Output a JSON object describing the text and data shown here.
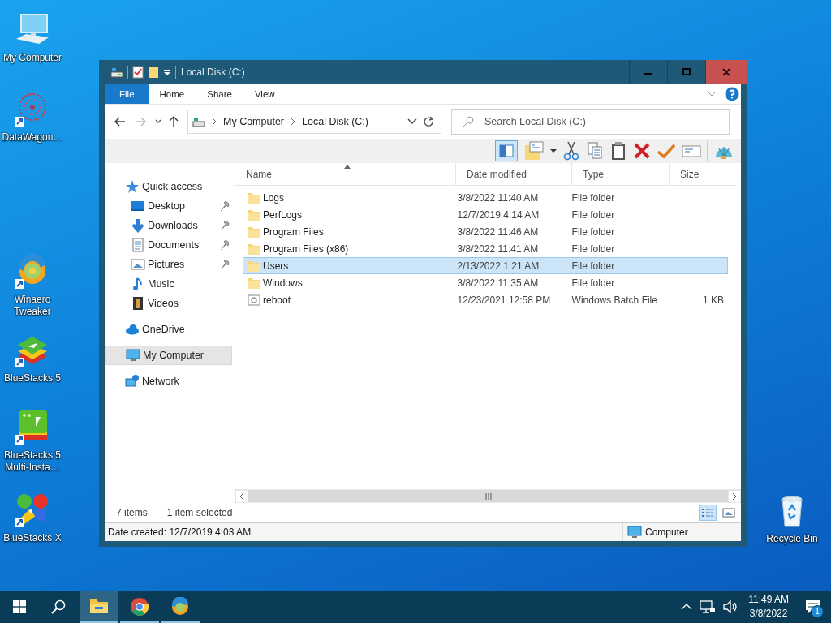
{
  "desktop_icons": [
    {
      "label": "My Computer",
      "kind": "computer",
      "shortcut": false
    },
    {
      "label": "DataWagon…",
      "kind": "datawagon",
      "shortcut": true
    },
    {
      "label": "Winaero Tweaker",
      "kind": "swirl",
      "shortcut": true
    },
    {
      "label": "BlueStacks 5",
      "kind": "stack",
      "shortcut": true
    },
    {
      "label": "BlueStacks 5 Multi-Insta…",
      "kind": "multi",
      "shortcut": true
    },
    {
      "label": "BlueStacks X",
      "kind": "xlogo",
      "shortcut": true
    },
    {
      "label": "Recycle Bin",
      "kind": "recycle",
      "shortcut": false
    }
  ],
  "window": {
    "title": "Local Disk (C:)",
    "ribbon_tabs": [
      {
        "label": "File",
        "kind": "file"
      },
      {
        "label": "Home",
        "kind": "tab"
      },
      {
        "label": "Share",
        "kind": "tab"
      },
      {
        "label": "View",
        "kind": "tab"
      }
    ],
    "breadcrumb": [
      "My Computer",
      "Local Disk (C:)"
    ],
    "search": {
      "placeholder": "Search Local Disk (C:)"
    },
    "nav": [
      {
        "label": "Quick access",
        "kind": "star",
        "selected": false,
        "children": [
          {
            "label": "Desktop",
            "kind": "desktop",
            "pinned": true,
            "selected": false
          },
          {
            "label": "Downloads",
            "kind": "download",
            "pinned": true,
            "selected": false
          },
          {
            "label": "Documents",
            "kind": "document",
            "pinned": true,
            "selected": false
          },
          {
            "label": "Pictures",
            "kind": "pictures",
            "pinned": true,
            "selected": false
          },
          {
            "label": "Music",
            "kind": "music",
            "pinned": false,
            "selected": false
          },
          {
            "label": "Videos",
            "kind": "videos",
            "pinned": false,
            "selected": false
          }
        ]
      },
      {
        "label": "OneDrive",
        "kind": "cloud",
        "selected": false
      },
      {
        "label": "My Computer",
        "kind": "computer",
        "selected": true
      },
      {
        "label": "Network",
        "kind": "network",
        "selected": false
      }
    ],
    "columns": [
      "Name",
      "Date modified",
      "Type",
      "Size"
    ],
    "rows": [
      {
        "name": "Logs",
        "date": "3/8/2022 11:40 AM",
        "type": "File folder",
        "kind": "folder",
        "selected": false
      },
      {
        "name": "PerfLogs",
        "date": "12/7/2019 4:14 AM",
        "type": "File folder",
        "kind": "folder",
        "selected": false
      },
      {
        "name": "Program Files",
        "date": "3/8/2022 11:46 AM",
        "type": "File folder",
        "kind": "folder",
        "selected": false
      },
      {
        "name": "Program Files (x86)",
        "date": "3/8/2022 11:41 AM",
        "type": "File folder",
        "kind": "folder",
        "selected": false
      },
      {
        "name": "Users",
        "date": "2/13/2022 1:21 AM",
        "type": "File folder",
        "kind": "folder",
        "selected": true
      },
      {
        "name": "Windows",
        "date": "3/8/2022 11:35 AM",
        "type": "File folder",
        "kind": "folder",
        "selected": false
      },
      {
        "name": "reboot",
        "date": "12/23/2021 12:58 PM",
        "type": "Windows Batch File",
        "size": "1 KB",
        "kind": "batch",
        "selected": false
      }
    ],
    "status": {
      "item_count": "7 items",
      "selection": "1 item selected"
    },
    "details_bar": {
      "info": "Date created: 12/7/2019 4:03 AM",
      "location": "Computer"
    }
  },
  "taskbar": {
    "apps": [
      {
        "kind": "explorer",
        "selected": true
      },
      {
        "kind": "chrome",
        "selected": false
      },
      {
        "kind": "swirl",
        "selected": false
      }
    ],
    "clock": {
      "time": "11:49 AM",
      "date": "3/8/2022"
    },
    "notification_count": "1"
  }
}
